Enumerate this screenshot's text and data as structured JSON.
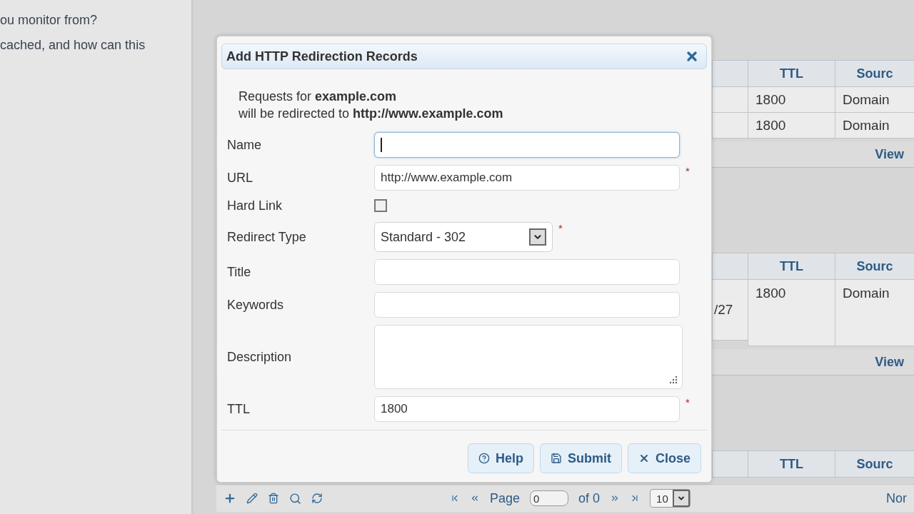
{
  "faq": [
    "ou monitor from?",
    "cached, and how can this"
  ],
  "panels": [
    {
      "header": [
        "TTL",
        "Sourc"
      ],
      "rows": [
        [
          "",
          "1800",
          "Domain"
        ],
        [
          "",
          "1800",
          "Domain"
        ]
      ],
      "footer": "View"
    },
    {
      "header": [
        "TTL",
        "Sourc"
      ],
      "rows": [
        [
          "/27",
          "1800",
          "Domain"
        ]
      ],
      "footer": "View"
    },
    {
      "header": [
        "TTL",
        "Sourc"
      ]
    }
  ],
  "pager": {
    "page_label": "Page",
    "page": "0",
    "of": "of 0",
    "size": "10",
    "right": "Nor"
  },
  "dialog": {
    "title": "Add HTTP Redirection Records",
    "intro": [
      "Requests for **example.com**",
      "will be redirected to **http://www.example.com**"
    ],
    "fields": [
      {
        "kind": "text",
        "label": "Name",
        "focused": true
      },
      {
        "kind": "text",
        "label": "URL",
        "value": "http://www.example.com",
        "required_mark": "*",
        "focused": false
      },
      {
        "kind": "checkbox",
        "label": "Hard Link",
        "checked": false
      },
      {
        "kind": "select",
        "label": "Redirect Type",
        "value": "Standard - 302",
        "required_mark": "*"
      },
      {
        "kind": "text",
        "label": "Title",
        "focused": false
      },
      {
        "kind": "text",
        "label": "Keywords",
        "focused": false
      },
      {
        "kind": "textarea",
        "label": "Description"
      },
      {
        "kind": "text",
        "label": "TTL",
        "value": "1800",
        "required_mark": "*",
        "focused": false
      }
    ],
    "buttons": [
      {
        "kind": "help",
        "label": "Help"
      },
      {
        "kind": "submit",
        "label": "Submit"
      },
      {
        "kind": "close",
        "label": "Close"
      }
    ]
  }
}
